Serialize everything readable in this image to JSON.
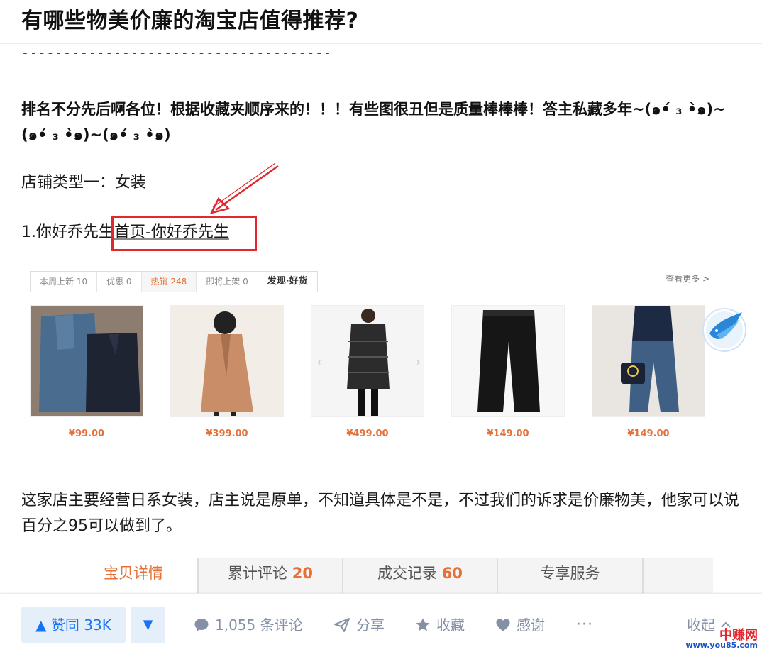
{
  "question": {
    "title": "有哪些物美价廉的淘宝店值得推荐?"
  },
  "answer": {
    "divider": "-------------------------------------",
    "intro": "排名不分先后啊各位！根据收藏夹顺序来的！！！有些图很丑但是质量棒棒棒！答主私藏多年~(๑•́ ₃ •̀๑)~(๑•́ ₃ •̀๑)~(๑•́ ₃ •̀๑)",
    "store_type": "店铺类型一：女装",
    "store_prefix": "1.你好乔先生",
    "store_link": "首页-你好乔先生",
    "description": "这家店主要经营日系女装，店主说是原单，不知道具体是不是，不过我们的诉求是价廉物美，他家可以说百分之95可以做到了。"
  },
  "shop": {
    "tabs": [
      {
        "label": "本周上新 10"
      },
      {
        "label": "优惠 0"
      },
      {
        "label": "热销 248"
      },
      {
        "label": "即将上架 0"
      },
      {
        "label": "发现·好货"
      }
    ],
    "see_more": "查看更多 >",
    "products": [
      {
        "price": "¥99.00",
        "image": "denim-jackets"
      },
      {
        "price": "¥399.00",
        "image": "camel-coat"
      },
      {
        "price": "¥499.00",
        "image": "puffer-coat"
      },
      {
        "price": "¥149.00",
        "image": "black-trousers"
      },
      {
        "price": "¥149.00",
        "image": "jeans-outfit"
      }
    ]
  },
  "detail_tabs": {
    "details": "宝贝详情",
    "reviews_label": "累计评论",
    "reviews_count": "20",
    "sales_label": "成交记录",
    "sales_count": "60",
    "service": "专享服务"
  },
  "actions": {
    "vote_up": "▲ 赞同 33K",
    "vote_down": "▼",
    "comments": "1,055 条评论",
    "share": "分享",
    "collect": "收藏",
    "thanks": "感谢",
    "more": "···",
    "fold": "收起"
  },
  "watermark": {
    "name": "中赚网",
    "url": "www.you85.com"
  },
  "colors": {
    "accent": "#1772f6",
    "price": "#e4713a",
    "annotation": "#e0282e",
    "muted": "#8590a6"
  }
}
